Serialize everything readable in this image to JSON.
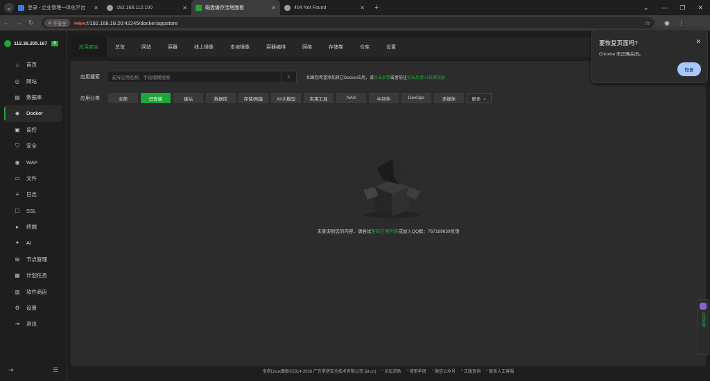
{
  "browser": {
    "tabs": [
      {
        "label": "登录 - 企业管理一体化平台",
        "fav_color": "#3b7dd8",
        "active": false
      },
      {
        "label": "192.168.112.100",
        "fav_color": "#9aa0a6",
        "active": false
      },
      {
        "label": "磁盘缓存宝塔面板",
        "fav_color": "#20a53a",
        "active": true
      },
      {
        "label": "404 Not Found",
        "fav_color": "#9aa0a6",
        "active": false
      }
    ],
    "new_tab": "+",
    "insecure_label": "不安全",
    "url_scheme": "https",
    "url_rest": "://192.168.18.20:42245/docker/appstore"
  },
  "sidebar": {
    "server_ip": "112.36.205.167",
    "server_badge": "0",
    "items": [
      {
        "label": "首页",
        "icon": "home-icon",
        "glyph": "⌂"
      },
      {
        "label": "网站",
        "icon": "globe-icon",
        "glyph": "◎"
      },
      {
        "label": "数据库",
        "icon": "database-icon",
        "glyph": "▤"
      },
      {
        "label": "Docker",
        "icon": "docker-icon",
        "glyph": "◆",
        "active": true
      },
      {
        "label": "监控",
        "icon": "monitor-icon",
        "glyph": "▣"
      },
      {
        "label": "安全",
        "icon": "shield-icon",
        "glyph": "⛉"
      },
      {
        "label": "WAF",
        "icon": "firewall-icon",
        "glyph": "◉"
      },
      {
        "label": "文件",
        "icon": "folder-icon",
        "glyph": "▭"
      },
      {
        "label": "日志",
        "icon": "log-icon",
        "glyph": "≡"
      },
      {
        "label": "SSL",
        "icon": "ssl-icon",
        "glyph": "☐"
      },
      {
        "label": "终端",
        "icon": "terminal-icon",
        "glyph": "▸"
      },
      {
        "label": "AI",
        "icon": "ai-icon",
        "glyph": "✦"
      },
      {
        "label": "节点管理",
        "icon": "node-icon",
        "glyph": "⊞"
      },
      {
        "label": "计划任务",
        "icon": "calendar-icon",
        "glyph": "▦"
      },
      {
        "label": "软件商店",
        "icon": "store-icon",
        "glyph": "▥"
      },
      {
        "label": "设置",
        "icon": "gear-icon",
        "glyph": "⚙"
      },
      {
        "label": "退出",
        "icon": "logout-icon",
        "glyph": "⇥"
      }
    ]
  },
  "subnav": {
    "tabs": [
      "应用商店",
      "总览",
      "网站",
      "容器",
      "线上镜像",
      "本地镜像",
      "容器编排",
      "网络",
      "存储卷",
      "仓库",
      "设置"
    ]
  },
  "search": {
    "label": "应用搜索",
    "placeholder": "支持应用名称、字段模糊搜索",
    "hint_prefix": "如果您希望添加其它Docker应用，请",
    "hint_link": "点击反馈",
    "hint_mid": "或者前往",
    "hint_link2": "论坛反馈",
    "hint_suffix": "+1获得奖励"
  },
  "categories": {
    "label": "应用分类",
    "items": [
      "全部",
      "已安装",
      "建站",
      "数据库",
      "存储/网盘",
      "AI/大模型",
      "实用工具",
      "NAS",
      "中间件",
      "DevOps",
      "多媒体"
    ],
    "active_index": 1,
    "more_label": "更多"
  },
  "empty": {
    "prefix": "未查询到您的内容，请尝试",
    "link": "更新应用列表",
    "suffix": "或加入QQ群：767189639反馈"
  },
  "footer": {
    "copyright": "宝塔Linux面板©2014-2026 广东堡塔安全技术有限公司 (bt.cn)",
    "links": [
      "论坛求助",
      "使用手册",
      "微信公众号",
      "正版查询",
      "联系人工客服"
    ]
  },
  "popup": {
    "title": "要恢复页面吗?",
    "message": "Chrome 未正确关闭。",
    "button": "恢复"
  },
  "float_widget": {
    "text": "在线客服"
  },
  "colors": {
    "accent": "#20a53a",
    "popup_button": "#a8c7fa"
  }
}
